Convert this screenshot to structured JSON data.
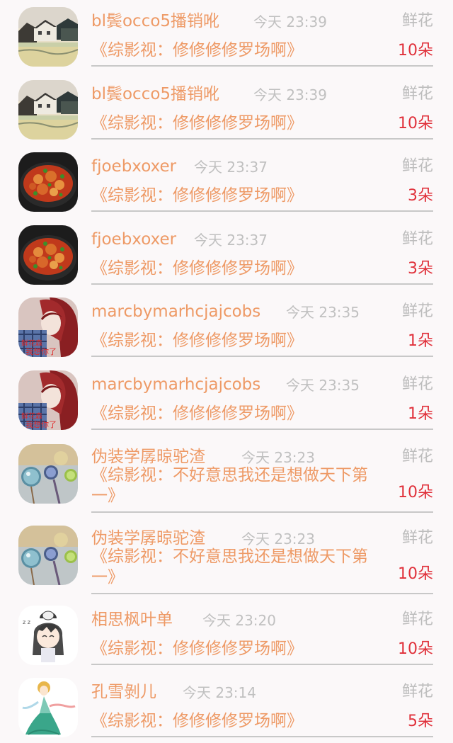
{
  "items": [
    {
      "avatar": "canal-town-photo",
      "name": "bl鬓occo5播销吪",
      "time": "今天 23:39",
      "gift_label": "鲜花",
      "description": "《综影视：修修修修罗场啊》",
      "count": "10朵"
    },
    {
      "avatar": "canal-town-photo",
      "name": "bl鬓occo5播销吪",
      "time": "今天 23:39",
      "gift_label": "鲜花",
      "description": "《综影视：修修修修罗场啊》",
      "count": "10朵"
    },
    {
      "avatar": "braised-chicken-photo",
      "name": "fjoebxoxer",
      "time": "今天 23:37",
      "gift_label": "鲜花",
      "description": "《综影视：修修修修罗场啊》",
      "count": "3朵"
    },
    {
      "avatar": "braised-chicken-photo",
      "name": "fjoebxoxer",
      "time": "今天 23:37",
      "gift_label": "鲜花",
      "description": "《综影视：修修修修罗场啊》",
      "count": "3朵"
    },
    {
      "avatar": "girl-plaid-photo",
      "name": "marcbymarhcjajcobs",
      "time": "今天 23:35",
      "gift_label": "鲜花",
      "description": "《综影视：修修修修罗场啊》",
      "count": "1朵"
    },
    {
      "avatar": "girl-plaid-photo",
      "name": "marcbymarhcjajcobs",
      "time": "今天 23:35",
      "gift_label": "鲜花",
      "description": "《综影视：修修修修罗场啊》",
      "count": "1朵"
    },
    {
      "avatar": "glass-charms-photo",
      "name": "伪装学孱晾驼渣",
      "time": "今天 23:23",
      "gift_label": "鲜花",
      "description": "《综影视：不好意思我还是想做天下第一》",
      "count": "10朵"
    },
    {
      "avatar": "glass-charms-photo",
      "name": "伪装学孱晾驼渣",
      "time": "今天 23:23",
      "gift_label": "鲜花",
      "description": "《综影视：不好意思我还是想做天下第一》",
      "count": "10朵"
    },
    {
      "avatar": "anime-cat-girl-avatar",
      "name": "相思枫叶单",
      "time": "今天 23:20",
      "gift_label": "鲜花",
      "description": "《综影视：修修修修罗场啊》",
      "count": "10朵"
    },
    {
      "avatar": "anime-fairy-avatar",
      "name": "孔雪剝儿",
      "time": "今天 23:14",
      "gift_label": "鲜花",
      "description": "《综影视：修修修修罗场啊》",
      "count": "5朵"
    }
  ]
}
